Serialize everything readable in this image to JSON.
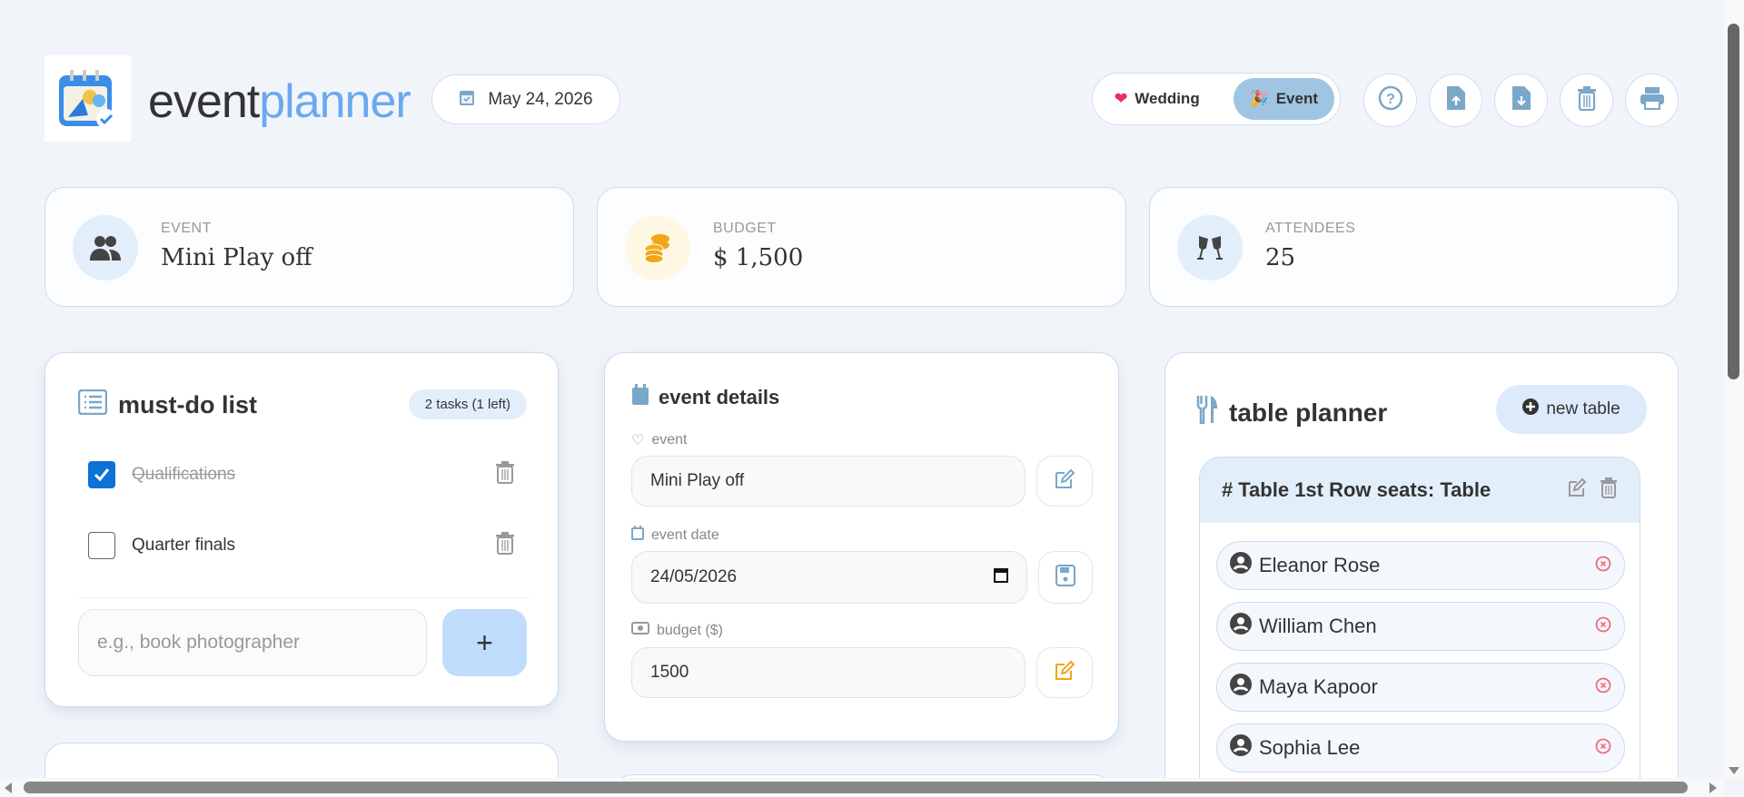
{
  "header": {
    "brand_a": "event",
    "brand_b": "planner",
    "date": "May 24, 2026",
    "modes": [
      {
        "label": "Wedding",
        "active": false
      },
      {
        "label": "Event",
        "active": true
      }
    ],
    "actions": [
      "help",
      "import",
      "export",
      "delete",
      "print"
    ]
  },
  "stats": [
    {
      "label": "EVENT",
      "value": "Mini Play off"
    },
    {
      "label": "BUDGET",
      "value": "$ 1,500"
    },
    {
      "label": "ATTENDEES",
      "value": "25"
    }
  ],
  "todo": {
    "title": "must-do list",
    "badge": "2 tasks (1 left)",
    "tasks": [
      {
        "label": "Qualifications",
        "done": true
      },
      {
        "label": "Quarter finals",
        "done": false
      }
    ],
    "placeholder": "e.g., book photographer",
    "add": "+"
  },
  "details": {
    "title": "event details",
    "event_label": "event",
    "event_value": "Mini Play off",
    "date_label": "event date",
    "date_value": "24/05/2026",
    "budget_label": "budget ($)",
    "budget_value": "1500"
  },
  "tables": {
    "title": "table planner",
    "new_table": "new table",
    "table_title": "Table 1st Row seats: Table",
    "guests": [
      "Eleanor Rose",
      "William Chen",
      "Maya Kapoor",
      "Sophia Lee"
    ]
  },
  "colors": {
    "accent": "#6aa9f0",
    "active_mode": "#9fc5e2",
    "icon": "#7ba7c9",
    "remove": "#f26b7a",
    "edit_budget": "#f2a516"
  }
}
